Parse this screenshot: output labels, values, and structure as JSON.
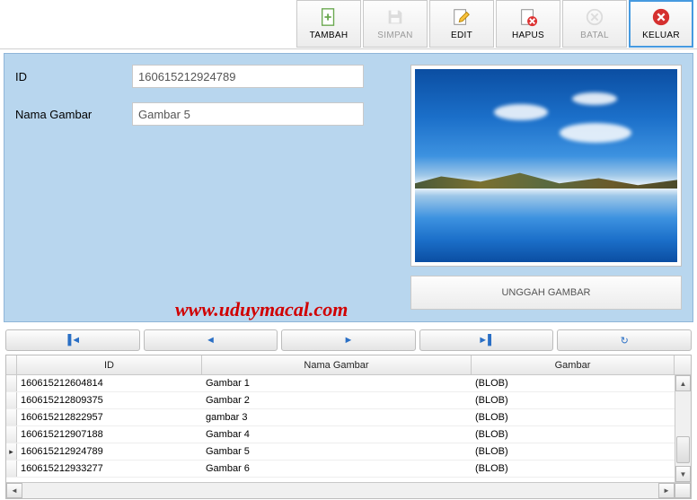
{
  "toolbar": {
    "tambah": "TAMBAH",
    "simpan": "SIMPAN",
    "edit": "EDIT",
    "hapus": "HAPUS",
    "batal": "BATAL",
    "keluar": "KELUAR"
  },
  "form": {
    "id_label": "ID",
    "id_value": "160615212924789",
    "nama_label": "Nama Gambar",
    "nama_value": "Gambar 5",
    "upload_label": "UNGGAH GAMBAR"
  },
  "watermark": "www.uduymacal.com",
  "grid": {
    "headers": {
      "id": "ID",
      "nama": "Nama Gambar",
      "gambar": "Gambar"
    },
    "rows": [
      {
        "id": "160615212604814",
        "nama": "Gambar 1",
        "gambar": "(BLOB)"
      },
      {
        "id": "160615212809375",
        "nama": "Gambar 2",
        "gambar": "(BLOB)"
      },
      {
        "id": "160615212822957",
        "nama": "gambar 3",
        "gambar": "(BLOB)"
      },
      {
        "id": "160615212907188",
        "nama": "Gambar 4",
        "gambar": "(BLOB)"
      },
      {
        "id": "160615212924789",
        "nama": "Gambar 5",
        "gambar": "(BLOB)"
      },
      {
        "id": "160615212933277",
        "nama": "Gambar 6",
        "gambar": "(BLOB)"
      }
    ],
    "current_row_index": 4
  }
}
